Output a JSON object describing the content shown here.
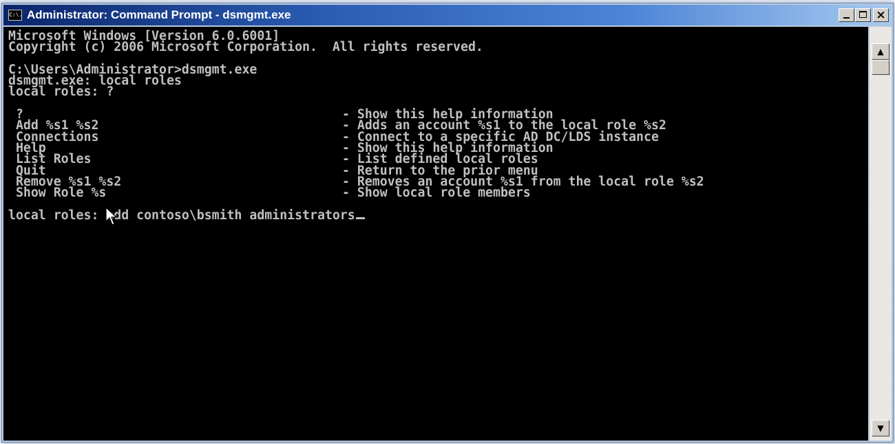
{
  "window": {
    "title": "Administrator: Command Prompt - dsmgmt.exe",
    "icon_label": "C:\\."
  },
  "title_buttons": {
    "minimize_icon": "minimize-icon",
    "maximize_icon": "maximize-icon",
    "close_label": "×"
  },
  "console": {
    "header_lines": [
      "Microsoft Windows [Version 6.0.6001]",
      "Copyright (c) 2006 Microsoft Corporation.  All rights reserved.",
      "",
      "C:\\Users\\Administrator>dsmgmt.exe",
      "dsmgmt.exe: local roles",
      "local roles: ?",
      ""
    ],
    "help_commands": [
      {
        "command": " ?",
        "description": "- Show this help information"
      },
      {
        "command": " Add %s1 %s2",
        "description": "- Adds an account %s1 to the local role %s2"
      },
      {
        "command": " Connections",
        "description": "- Connect to a specific AD DC/LDS instance"
      },
      {
        "command": " Help",
        "description": "- Show this help information"
      },
      {
        "command": " List Roles",
        "description": "- List defined local roles"
      },
      {
        "command": " Quit",
        "description": "- Return to the prior menu"
      },
      {
        "command": " Remove %s1 %s2",
        "description": "- Removes an account %s1 from the local role %s2"
      },
      {
        "command": " Show Role %s",
        "description": "- Show local role members"
      }
    ],
    "prompt": "local roles: ",
    "typed_input": "add contoso\\bsmith administrators"
  },
  "scrollbar": {
    "up_arrow": "▲",
    "down_arrow": "▼"
  },
  "colors": {
    "console_background": "#000000",
    "console_text": "#c0c0c0",
    "titlebar_start": "#0a246a",
    "titlebar_end": "#a6caf0"
  }
}
